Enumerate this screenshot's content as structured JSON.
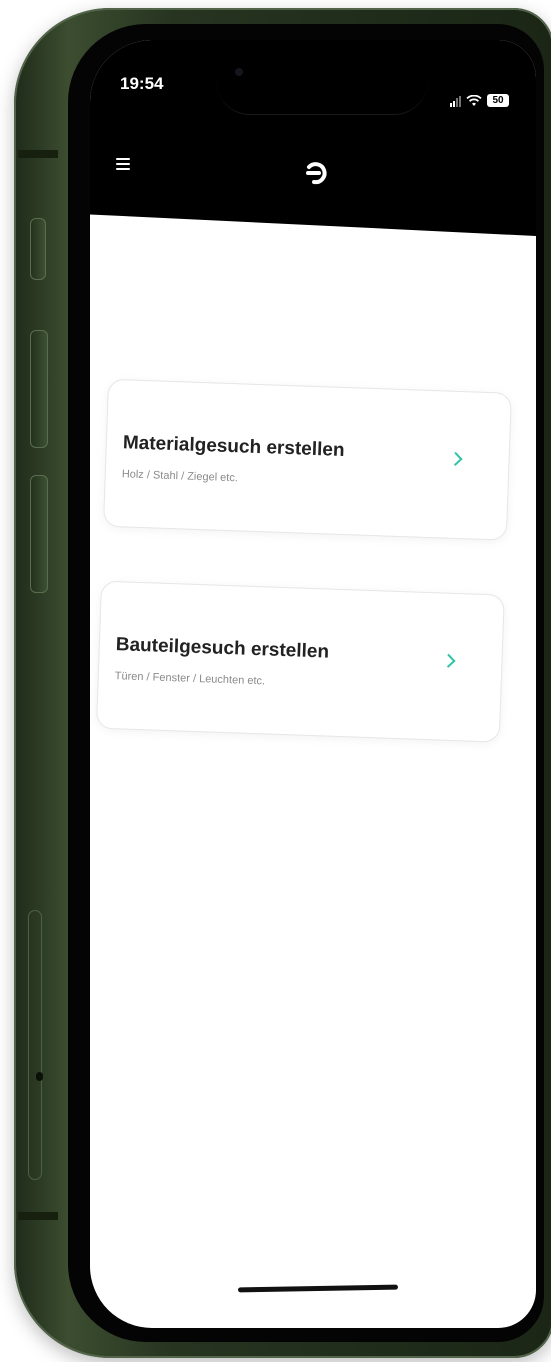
{
  "status_bar": {
    "time": "19:54",
    "battery": "50"
  },
  "header": {
    "menu_icon": "hamburger-menu-icon",
    "logo_icon": "app-logo-icon"
  },
  "cards": [
    {
      "title": "Materialgesuch erstellen",
      "subtitle": "Holz / Stahl / Ziegel etc.",
      "icon": "chevron-right-icon"
    },
    {
      "title": "Bauteilgesuch erstellen",
      "subtitle": "Türen / Fenster / Leuchten etc.",
      "icon": "chevron-right-icon"
    }
  ],
  "colors": {
    "accent": "#2ec4a5",
    "header": "#000000",
    "phone_frame": "#2f3f27"
  }
}
